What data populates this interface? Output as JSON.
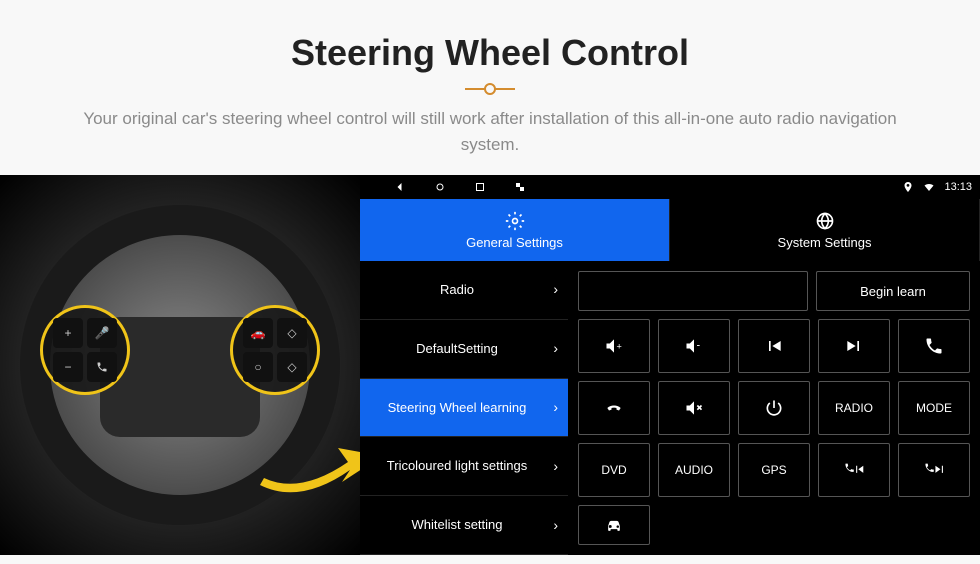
{
  "header": {
    "title": "Steering Wheel Control",
    "subtitle": "Your original car's steering wheel control will still work after installation of this all-in-one auto radio navigation system."
  },
  "statusbar": {
    "time": "13:13",
    "nav_icons": [
      "back",
      "home",
      "recent",
      "screenshot"
    ],
    "status_icons": [
      "gps",
      "wifi"
    ]
  },
  "tabs": [
    {
      "label": "General Settings",
      "icon": "gear",
      "active": true
    },
    {
      "label": "System Settings",
      "icon": "globe",
      "active": false
    }
  ],
  "menu": [
    {
      "label": "Radio",
      "active": false
    },
    {
      "label": "DefaultSetting",
      "active": false
    },
    {
      "label": "Steering Wheel learning",
      "active": true
    },
    {
      "label": "Tricoloured light settings",
      "active": false
    },
    {
      "label": "Whitelist setting",
      "active": false
    }
  ],
  "action": {
    "begin_learn": "Begin learn"
  },
  "buttons": {
    "row1": [
      "vol-up",
      "vol-down",
      "prev-track",
      "next-track",
      "phone"
    ],
    "row2": [
      "hangup",
      "mute",
      "power",
      "RADIO",
      "MODE"
    ],
    "row3": [
      "DVD",
      "AUDIO",
      "GPS",
      "phone-prev",
      "phone-next"
    ],
    "row4": [
      "car"
    ]
  },
  "wheel_controls": {
    "left": [
      "plus",
      "voice",
      "minus",
      "phone"
    ],
    "right": [
      "car",
      "up",
      "circle",
      "down"
    ]
  }
}
